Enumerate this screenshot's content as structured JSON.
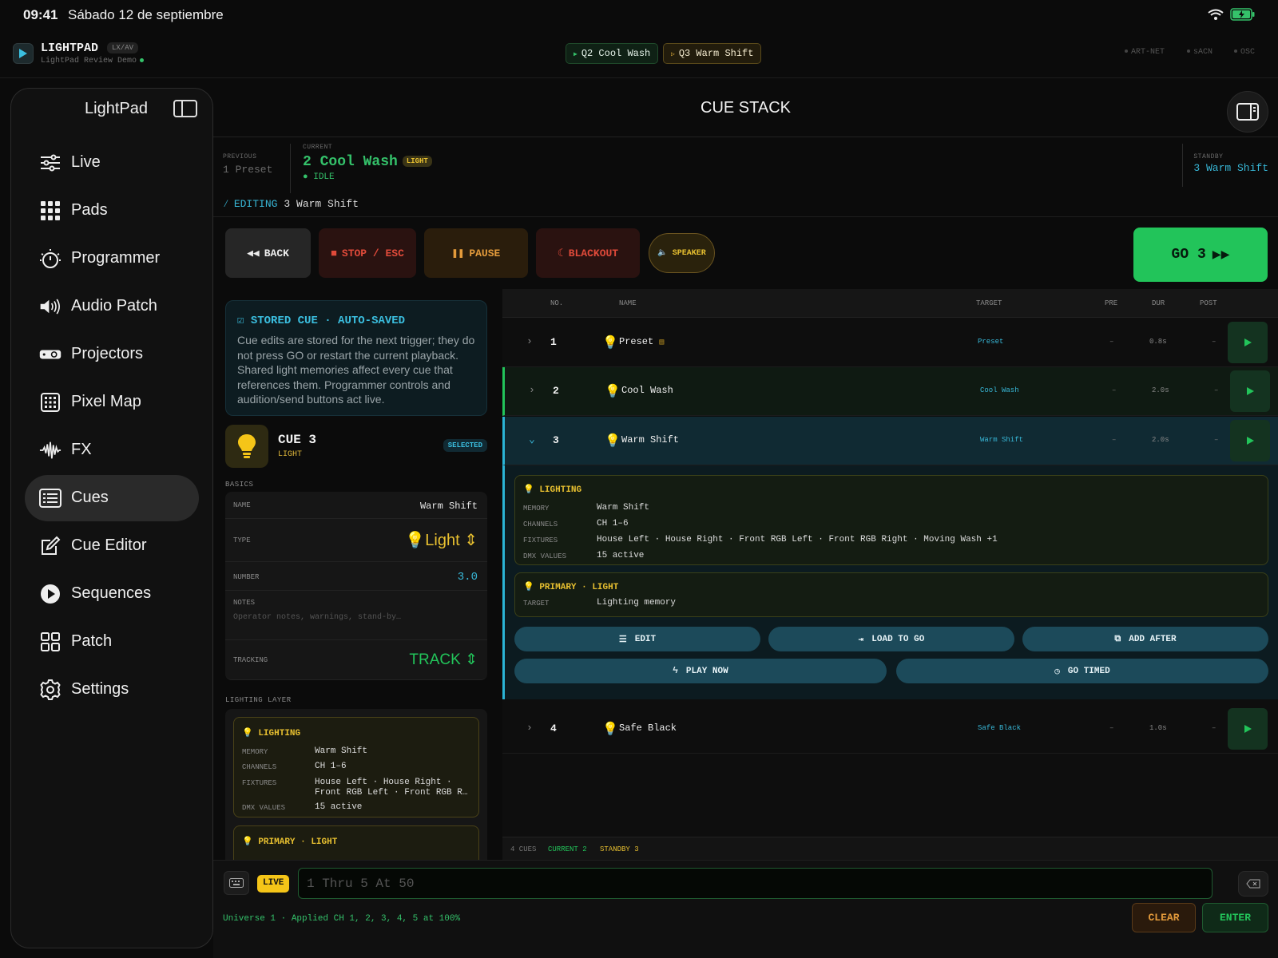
{
  "status": {
    "time": "09:41",
    "date": "Sábado 12 de septiembre"
  },
  "app": {
    "name": "LIGHTPAD",
    "badge": "LX/AV",
    "subtitle": "LightPad Review Demo"
  },
  "topchips": [
    {
      "label": "Q2 Cool Wash"
    },
    {
      "label": "Q3 Warm Shift"
    }
  ],
  "protocols": [
    "ART-NET",
    "sACN",
    "OSC"
  ],
  "sidebar": {
    "title": "LightPad",
    "items": [
      {
        "label": "Live",
        "icon": "sliders-icon"
      },
      {
        "label": "Pads",
        "icon": "grid-icon"
      },
      {
        "label": "Programmer",
        "icon": "sun-dial-icon"
      },
      {
        "label": "Audio Patch",
        "icon": "speaker-icon"
      },
      {
        "label": "Projectors",
        "icon": "projector-icon"
      },
      {
        "label": "Pixel Map",
        "icon": "pixel-map-icon"
      },
      {
        "label": "FX",
        "icon": "waveform-icon"
      },
      {
        "label": "Cues",
        "icon": "list-icon",
        "active": true
      },
      {
        "label": "Cue Editor",
        "icon": "edit-icon"
      },
      {
        "label": "Sequences",
        "icon": "play-circle-icon"
      },
      {
        "label": "Patch",
        "icon": "patch-grid-icon"
      },
      {
        "label": "Settings",
        "icon": "gear-icon"
      }
    ]
  },
  "header": {
    "title": "CUE STACK"
  },
  "playback": {
    "previous_label": "PREVIOUS",
    "previous": "1 Preset",
    "current_label": "CURRENT",
    "current": "2 Cool Wash",
    "current_badge": "LIGHT",
    "current_state": "IDLE",
    "standby_label": "STANDBY",
    "standby": "3 Warm Shift",
    "editing_label": "EDITING",
    "editing": "3 Warm Shift"
  },
  "transport": {
    "back": "BACK",
    "stop": "STOP / ESC",
    "pause": "PAUSE",
    "blackout": "BLACKOUT",
    "speaker": "SPEAKER",
    "go": "GO 3"
  },
  "notice": {
    "title": "STORED CUE · AUTO-SAVED",
    "body": "Cue edits are stored for the next trigger; they do not press GO or restart the current playback. Shared light memories affect every cue that references them. Programmer controls and audition/send buttons act live."
  },
  "cue": {
    "title": "CUE 3",
    "kind": "LIGHT",
    "selected": "SELECTED",
    "basics_label": "BASICS",
    "name_label": "NAME",
    "name": "Warm Shift",
    "type_label": "TYPE",
    "type": "Light",
    "number_label": "NUMBER",
    "number": "3.0",
    "notes_label": "NOTES",
    "notes_placeholder": "Operator notes, warnings, stand-by…",
    "tracking_label": "TRACKING",
    "tracking": "TRACK",
    "layer_label": "LIGHTING LAYER",
    "layer": {
      "title": "LIGHTING",
      "memory_label": "MEMORY",
      "memory": "Warm Shift",
      "channels_label": "CHANNELS",
      "channels": "CH 1–6",
      "fixtures_label": "FIXTURES",
      "fixtures": "House Left · House Right · Front RGB Left · Front RGB R…",
      "dmx_label": "DMX VALUES",
      "dmx": "15 active"
    },
    "primary": "PRIMARY · LIGHT"
  },
  "table": {
    "headers": {
      "no": "NO.",
      "name": "NAME",
      "target": "TARGET",
      "pre": "PRE",
      "dur": "DUR",
      "post": "POST"
    },
    "rows": [
      {
        "no": "1",
        "name": "Preset",
        "target": "Preset",
        "pre": "–",
        "dur": "0.8s",
        "post": "–"
      },
      {
        "no": "2",
        "name": "Cool Wash",
        "target": "Cool Wash",
        "pre": "–",
        "dur": "2.0s",
        "post": "–"
      },
      {
        "no": "3",
        "name": "Warm Shift",
        "target": "Warm Shift",
        "pre": "–",
        "dur": "2.0s",
        "post": "–"
      },
      {
        "no": "4",
        "name": "Safe Black",
        "target": "Safe Black",
        "pre": "–",
        "dur": "1.0s",
        "post": "–"
      }
    ],
    "expanded": {
      "lighting": "LIGHTING",
      "memory_label": "MEMORY",
      "memory": "Warm Shift",
      "channels_label": "CHANNELS",
      "channels": "CH 1–6",
      "fixtures_label": "FIXTURES",
      "fixtures": "House Left · House Right · Front RGB Left · Front RGB Right · Moving Wash +1",
      "dmx_label": "DMX VALUES",
      "dmx": "15 active",
      "primary": "PRIMARY · LIGHT",
      "target_label": "TARGET",
      "target": "Lighting memory",
      "buttons": {
        "edit": "EDIT",
        "load": "LOAD TO GO",
        "add": "ADD AFTER",
        "play": "PLAY NOW",
        "timed": "GO TIMED"
      }
    },
    "footer": {
      "count": "4 CUES",
      "current": "CURRENT 2",
      "standby": "STANDBY 3"
    }
  },
  "command": {
    "live": "LIVE",
    "placeholder": "1 Thru 5 At 50",
    "log": "Universe 1 · Applied CH 1, 2, 3, 4, 5 at 100%",
    "clear": "CLEAR",
    "enter": "ENTER"
  },
  "colors": {
    "green": "#22c45a",
    "cyan": "#38b8d8",
    "yellow": "#e8c030",
    "red": "#e04a3a",
    "orange": "#e39a3b"
  }
}
